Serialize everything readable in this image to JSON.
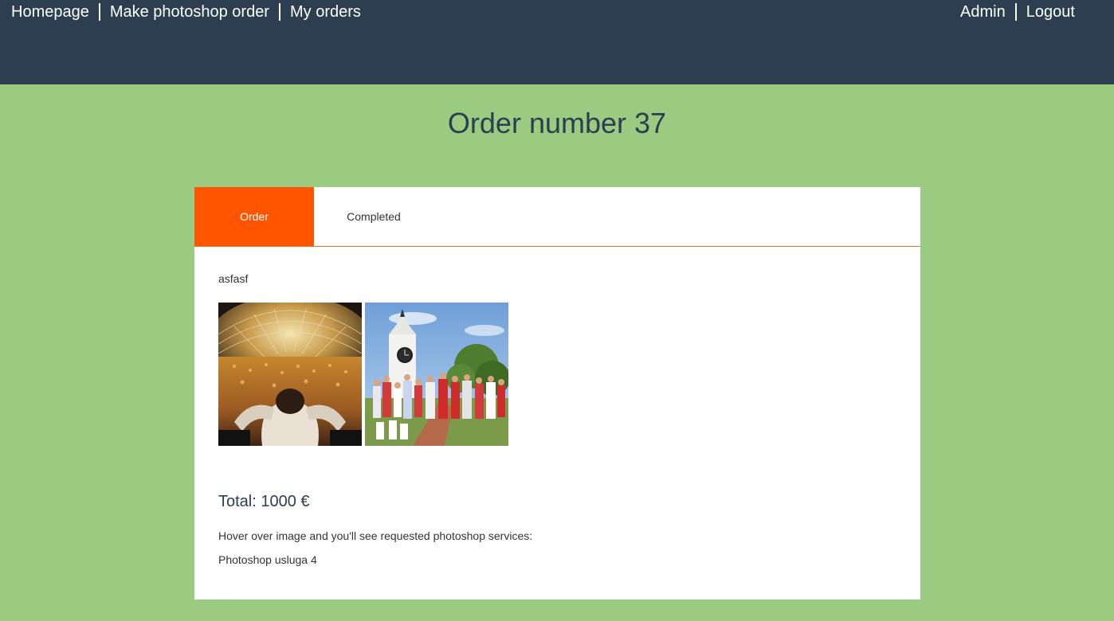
{
  "nav": {
    "left": [
      {
        "label": "Homepage"
      },
      {
        "label": "Make photoshop order"
      },
      {
        "label": "My orders"
      }
    ],
    "right": [
      {
        "label": "Admin"
      },
      {
        "label": "Logout"
      }
    ]
  },
  "page": {
    "title": "Order number 37"
  },
  "tabs": [
    {
      "label": "Order",
      "active": true
    },
    {
      "label": "Completed",
      "active": false
    }
  ],
  "order": {
    "description": "asfasf",
    "images": [
      {
        "name": "concert-crowd-photo"
      },
      {
        "name": "clock-tower-group-photo"
      }
    ],
    "total": "Total: 1000 €",
    "hint": "Hover over image and you'll see requested photoshop services:",
    "services": [
      "Photoshop usluga 4"
    ]
  },
  "colors": {
    "topbar": "#2c3e50",
    "background": "#9acb80",
    "active_tab": "#ff5500",
    "title": "#2c3e50"
  }
}
